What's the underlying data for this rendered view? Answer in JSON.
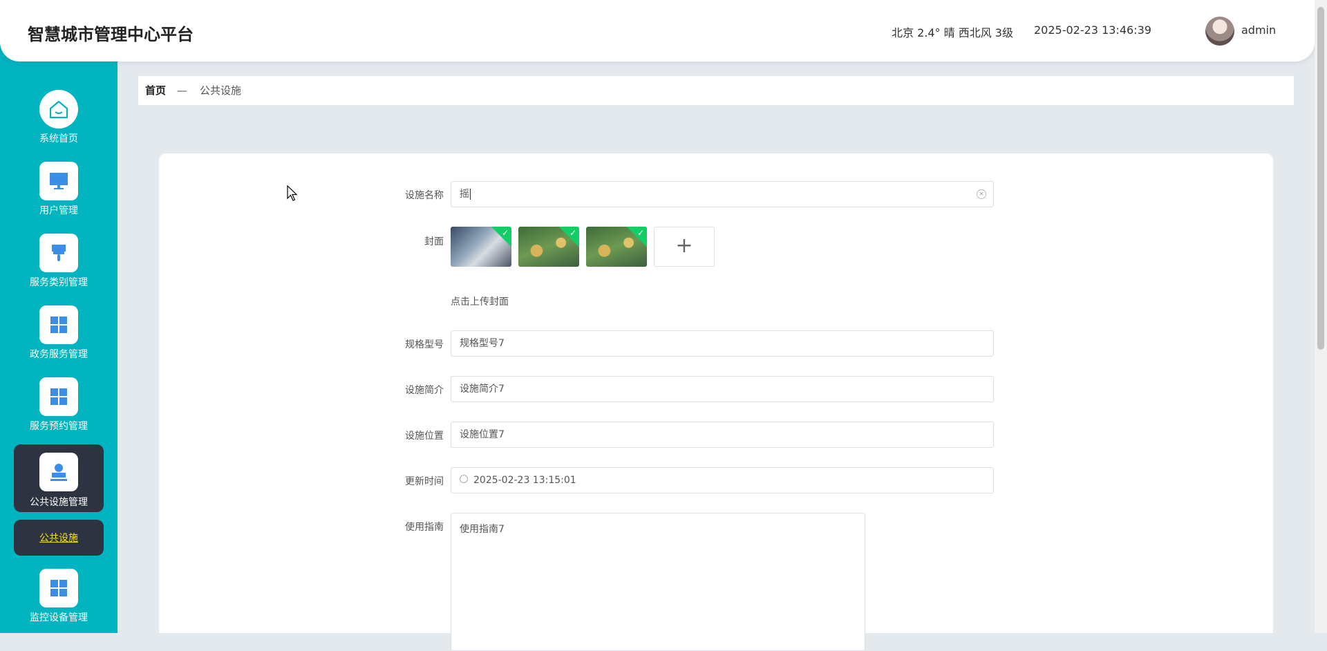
{
  "header": {
    "title": "智慧城市管理中心平台",
    "weather": "北京  2.4°  晴  西北风  3级",
    "datetime": "2025-02-23 13:46:39",
    "username": "admin"
  },
  "sidebar": {
    "items": [
      {
        "label": "系统首页",
        "icon": "home-icon"
      },
      {
        "label": "用户管理",
        "icon": "monitor-icon"
      },
      {
        "label": "服务类别管理",
        "icon": "brush-icon"
      },
      {
        "label": "政务服务管理",
        "icon": "grid-icon"
      },
      {
        "label": "服务预约管理",
        "icon": "grid-icon"
      },
      {
        "label": "公共设施管理",
        "icon": "stamp-icon"
      },
      {
        "label": "监控设备管理",
        "icon": "grid-icon"
      }
    ],
    "sub_item": "公共设施"
  },
  "breadcrumb": {
    "home": "首页",
    "separator": "—",
    "current": "公共设施"
  },
  "form": {
    "name_label": "设施名称",
    "name_value": "摇",
    "cover_label": "封面",
    "cover_hint": "点击上传封面",
    "spec_label": "规格型号",
    "spec_value": "规格型号7",
    "intro_label": "设施简介",
    "intro_value": "设施简介7",
    "location_label": "设施位置",
    "location_value": "设施位置7",
    "update_label": "更新时间",
    "update_value": "2025-02-23 13:15:01",
    "guide_label": "使用指南",
    "guide_value": "使用指南7"
  },
  "colors": {
    "sidebar": "#00b4c0",
    "active": "#2d3341",
    "icon": "#3a8ee6",
    "success": "#13ce66"
  }
}
